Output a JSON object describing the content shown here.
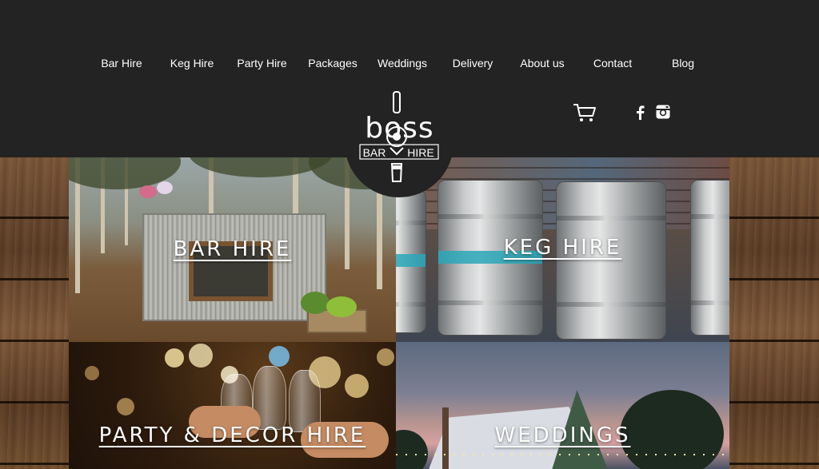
{
  "nav": {
    "items": [
      {
        "label": "Bar Hire"
      },
      {
        "label": "Keg Hire"
      },
      {
        "label": "Party Hire"
      },
      {
        "label": "Packages"
      },
      {
        "label": "Weddings"
      },
      {
        "label": "Delivery"
      },
      {
        "label": "About us"
      },
      {
        "label": "Contact"
      },
      {
        "label": "Blog"
      }
    ]
  },
  "logo": {
    "word": "boss",
    "left": "BAR",
    "right": "HIRE"
  },
  "header_icons": [
    "cart-icon",
    "facebook-icon",
    "instagram-icon"
  ],
  "tiles": {
    "bar_hire": {
      "label": "BAR HIRE"
    },
    "keg_hire": {
      "label": "KEG HIRE"
    },
    "party_hire": {
      "label": "PARTY & DECOR HIRE"
    },
    "weddings": {
      "label": "WEDDINGS"
    }
  },
  "colors": {
    "header_bg": "#232323",
    "nav_text": "#ffffff",
    "keg_band": "#2aa7b8"
  }
}
